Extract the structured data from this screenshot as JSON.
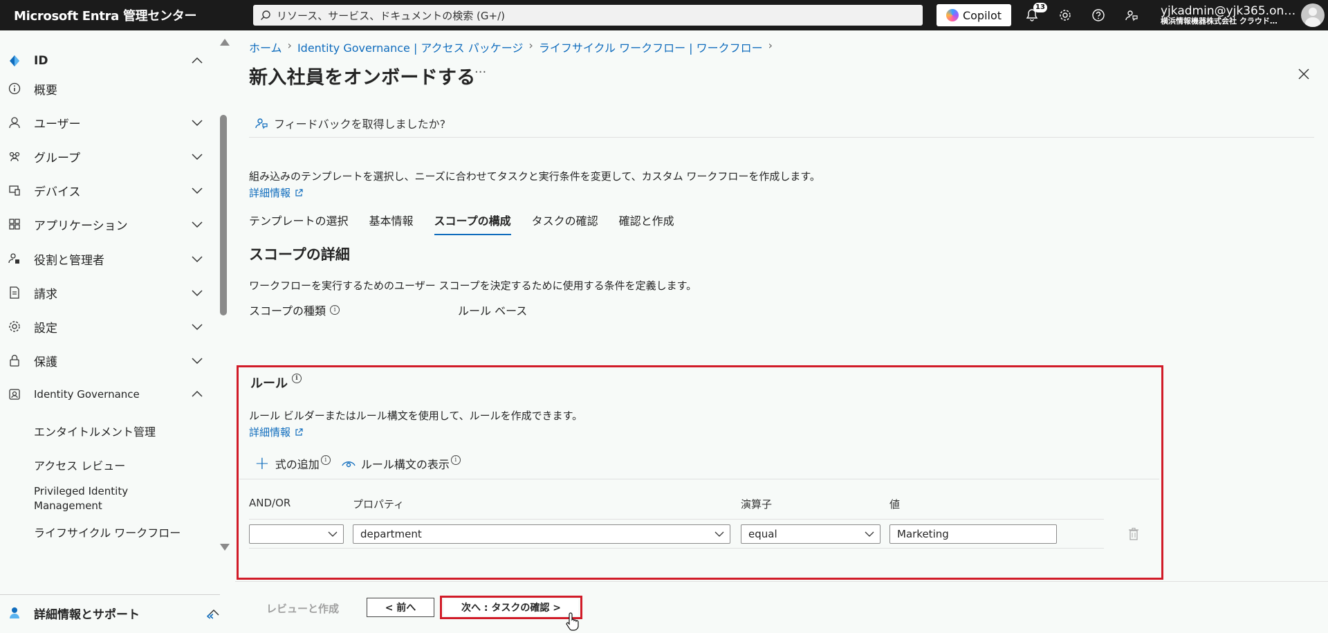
{
  "topbar": {
    "brand": "Microsoft Entra 管理センター",
    "search_placeholder": "リソース、サービス、ドキュメントの検索 (G+/)",
    "copilot": "Copilot",
    "notification_count": "13",
    "upn": "yjkadmin@yjk365.on…",
    "org": "横浜情報機器株式会社 クラウド…"
  },
  "sidebar": {
    "items": [
      {
        "label": "ID",
        "icon": "diamond-icon"
      },
      {
        "label": "概要",
        "icon": "info-circle-icon"
      },
      {
        "label": "ユーザー",
        "icon": "person-icon"
      },
      {
        "label": "グループ",
        "icon": "group-icon"
      },
      {
        "label": "デバイス",
        "icon": "device-icon"
      },
      {
        "label": "アプリケーション",
        "icon": "apps-grid-icon"
      },
      {
        "label": "役割と管理者",
        "icon": "role-icon"
      },
      {
        "label": "請求",
        "icon": "billing-icon"
      },
      {
        "label": "設定",
        "icon": "gear-icon"
      },
      {
        "label": "保護",
        "icon": "lock-icon"
      },
      {
        "label": "Identity Governance",
        "icon": "governance-icon"
      }
    ],
    "sub_items": [
      "エンタイトルメント管理",
      "アクセス レビュー",
      "Privileged Identity",
      "Management",
      "ライフサイクル ワークフロー"
    ],
    "support": "詳細情報とサポート",
    "collapse": "«"
  },
  "breadcrumb": [
    "ホーム",
    "Identity Governance | アクセス パッケージ",
    "ライフサイクル ワークフロー | ワークフロー"
  ],
  "page": {
    "title": "新入社員をオンボードする",
    "more": "···",
    "feedback": "フィードバックを取得しましたか?",
    "intro": "組み込みのテンプレートを選択し、ニーズに合わせてタスクと実行条件を変更して、カスタム ワークフローを作成します。",
    "learn_more": "詳細情報"
  },
  "tabs": [
    "テンプレートの選択",
    "基本情報",
    "スコープの構成",
    "タスクの確認",
    "確認と作成"
  ],
  "scope": {
    "title": "スコープの詳細",
    "desc": "ワークフローを実行するためのユーザー スコープを決定するために使用する条件を定義します。",
    "type_label": "スコープの種類",
    "type_value": "ルール ベース"
  },
  "rule": {
    "title": "ルール",
    "desc": "ルール ビルダーまたはルール構文を使用して、ルールを作成できます。",
    "learn_more": "詳細情報",
    "add_expression": "式の追加",
    "show_syntax": "ルール構文の表示",
    "headers": [
      "AND/OR",
      "プロパティ",
      "演算子",
      "値"
    ],
    "row": {
      "andor": "",
      "property": "department",
      "operator": "equal",
      "value": "Marketing"
    }
  },
  "footer": {
    "review": "レビューと作成",
    "prev": "< 前へ",
    "next": "次へ : タスクの確認 >"
  }
}
